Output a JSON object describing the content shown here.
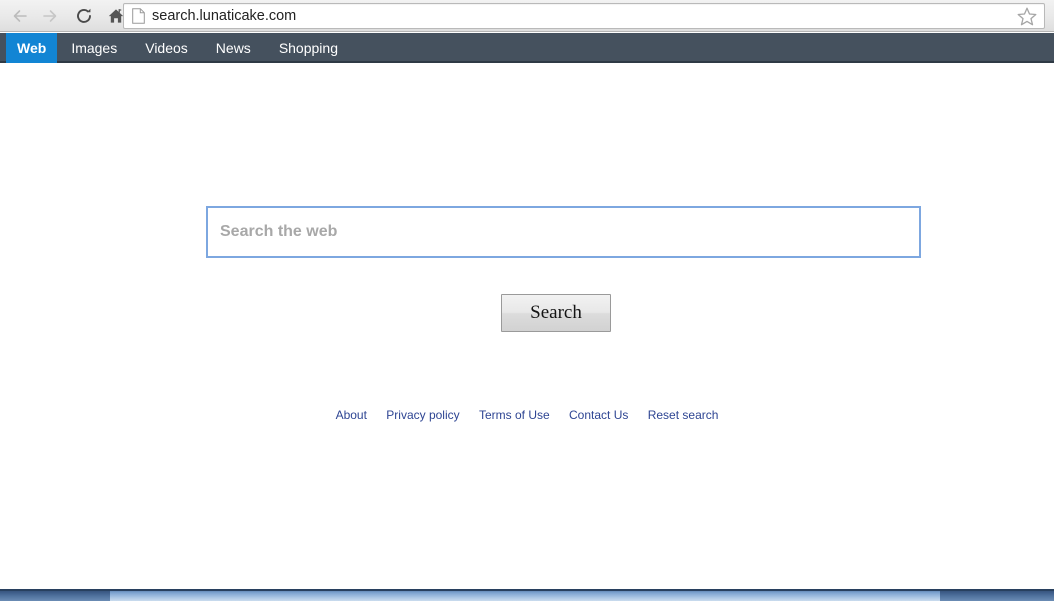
{
  "browser": {
    "back_label": "Back",
    "forward_label": "Forward",
    "reload_label": "Reload",
    "home_label": "Home",
    "url": "search.lunaticake.com",
    "bookmark_label": "Bookmark this page",
    "page_icon_name": "page-icon",
    "star_icon_name": "star-icon"
  },
  "site_nav": {
    "items": [
      {
        "label": "Web",
        "active": true
      },
      {
        "label": "Images",
        "active": false
      },
      {
        "label": "Videos",
        "active": false
      },
      {
        "label": "News",
        "active": false
      },
      {
        "label": "Shopping",
        "active": false
      }
    ],
    "active_color": "#1285d4",
    "bar_color": "#45515e"
  },
  "search": {
    "value": "",
    "placeholder": "Search the web",
    "button_label": "Search",
    "border_color": "#7da7e0"
  },
  "footer": {
    "links": [
      {
        "label": "About"
      },
      {
        "label": "Privacy policy"
      },
      {
        "label": "Terms of Use"
      },
      {
        "label": "Contact Us"
      },
      {
        "label": "Reset search"
      }
    ],
    "link_color": "#2e4593"
  }
}
